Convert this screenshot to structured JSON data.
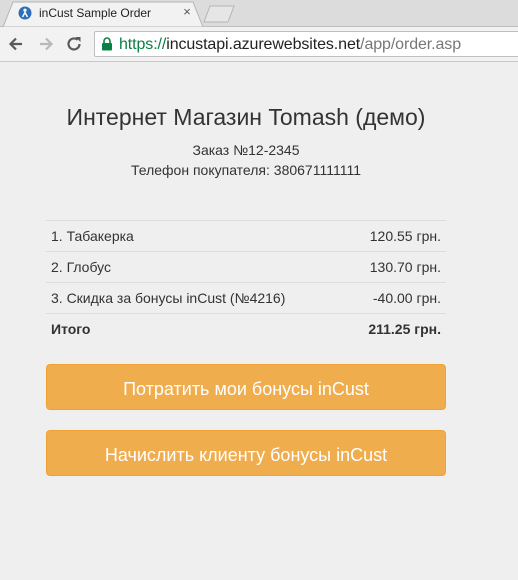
{
  "browser": {
    "tab_title": "inCust Sample Order",
    "tab_close": "×",
    "url_scheme": "https://",
    "url_host": "incustapi.azurewebsites.net",
    "url_path": "/app/order.asp",
    "secure_color": "#0b8043"
  },
  "page": {
    "shop_title": "Интернет Магазин Tomash (демо)",
    "order_number": "Заказ №12-2345",
    "customer_phone": "Телефон покупателя: 380671111111"
  },
  "order": {
    "items": [
      {
        "label": "1. Табакерка",
        "price": "120.55 грн."
      },
      {
        "label": "2. Глобус",
        "price": "130.70 грн."
      },
      {
        "label": "3. Скидка за бонусы inCust (№4216)",
        "price": "-40.00 грн."
      }
    ],
    "total_label": "Итого",
    "total_price": "211.25 грн."
  },
  "actions": {
    "spend_bonuses": "Потратить мои бонусы inCust",
    "credit_bonuses": "Начислить клиенту бонусы inCust",
    "button_color": "#f0ad4e"
  },
  "icons": [
    "incust-favicon-icon",
    "close-icon",
    "back-arrow-icon",
    "forward-arrow-icon",
    "reload-icon",
    "lock-icon"
  ]
}
